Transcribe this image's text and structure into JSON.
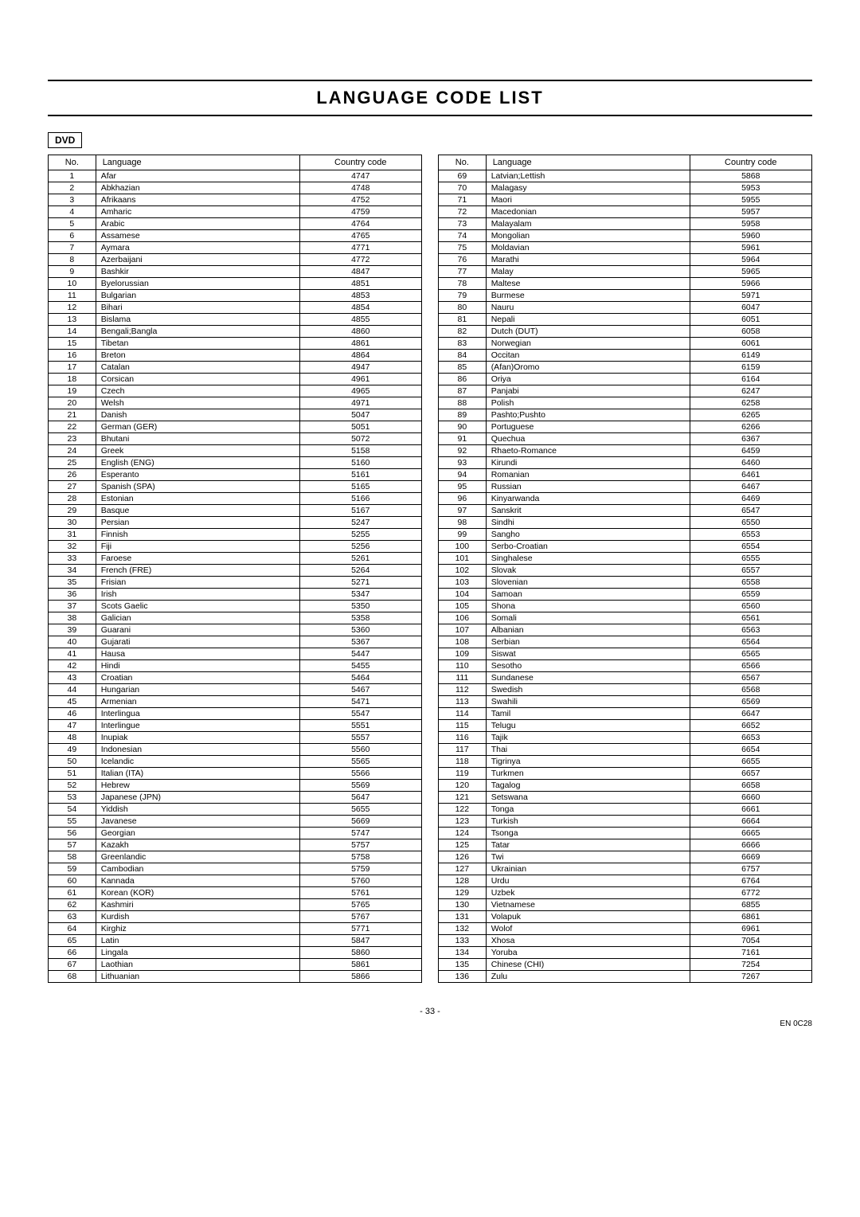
{
  "title": "LANGUAGE CODE LIST",
  "dvd_label": "DVD",
  "footer_page": "- 33 -",
  "footer_code": "EN\n0C28",
  "columns": {
    "no": "No.",
    "language": "Language",
    "country_code": "Country code"
  },
  "left_table": [
    {
      "no": 1,
      "lang": "Afar",
      "code": "4747"
    },
    {
      "no": 2,
      "lang": "Abkhazian",
      "code": "4748"
    },
    {
      "no": 3,
      "lang": "Afrikaans",
      "code": "4752"
    },
    {
      "no": 4,
      "lang": "Amharic",
      "code": "4759"
    },
    {
      "no": 5,
      "lang": "Arabic",
      "code": "4764"
    },
    {
      "no": 6,
      "lang": "Assamese",
      "code": "4765"
    },
    {
      "no": 7,
      "lang": "Aymara",
      "code": "4771"
    },
    {
      "no": 8,
      "lang": "Azerbaijani",
      "code": "4772"
    },
    {
      "no": 9,
      "lang": "Bashkir",
      "code": "4847"
    },
    {
      "no": 10,
      "lang": "Byelorussian",
      "code": "4851"
    },
    {
      "no": 11,
      "lang": "Bulgarian",
      "code": "4853"
    },
    {
      "no": 12,
      "lang": "Bihari",
      "code": "4854"
    },
    {
      "no": 13,
      "lang": "Bislama",
      "code": "4855"
    },
    {
      "no": 14,
      "lang": "Bengali;Bangla",
      "code": "4860"
    },
    {
      "no": 15,
      "lang": "Tibetan",
      "code": "4861"
    },
    {
      "no": 16,
      "lang": "Breton",
      "code": "4864"
    },
    {
      "no": 17,
      "lang": "Catalan",
      "code": "4947"
    },
    {
      "no": 18,
      "lang": "Corsican",
      "code": "4961"
    },
    {
      "no": 19,
      "lang": "Czech",
      "code": "4965"
    },
    {
      "no": 20,
      "lang": "Welsh",
      "code": "4971"
    },
    {
      "no": 21,
      "lang": "Danish",
      "code": "5047"
    },
    {
      "no": 22,
      "lang": "German (GER)",
      "code": "5051"
    },
    {
      "no": 23,
      "lang": "Bhutani",
      "code": "5072"
    },
    {
      "no": 24,
      "lang": "Greek",
      "code": "5158"
    },
    {
      "no": 25,
      "lang": "English (ENG)",
      "code": "5160"
    },
    {
      "no": 26,
      "lang": "Esperanto",
      "code": "5161"
    },
    {
      "no": 27,
      "lang": "Spanish (SPA)",
      "code": "5165"
    },
    {
      "no": 28,
      "lang": "Estonian",
      "code": "5166"
    },
    {
      "no": 29,
      "lang": "Basque",
      "code": "5167"
    },
    {
      "no": 30,
      "lang": "Persian",
      "code": "5247"
    },
    {
      "no": 31,
      "lang": "Finnish",
      "code": "5255"
    },
    {
      "no": 32,
      "lang": "Fiji",
      "code": "5256"
    },
    {
      "no": 33,
      "lang": "Faroese",
      "code": "5261"
    },
    {
      "no": 34,
      "lang": "French (FRE)",
      "code": "5264"
    },
    {
      "no": 35,
      "lang": "Frisian",
      "code": "5271"
    },
    {
      "no": 36,
      "lang": "Irish",
      "code": "5347"
    },
    {
      "no": 37,
      "lang": "Scots Gaelic",
      "code": "5350"
    },
    {
      "no": 38,
      "lang": "Galician",
      "code": "5358"
    },
    {
      "no": 39,
      "lang": "Guarani",
      "code": "5360"
    },
    {
      "no": 40,
      "lang": "Gujarati",
      "code": "5367"
    },
    {
      "no": 41,
      "lang": "Hausa",
      "code": "5447"
    },
    {
      "no": 42,
      "lang": "Hindi",
      "code": "5455"
    },
    {
      "no": 43,
      "lang": "Croatian",
      "code": "5464"
    },
    {
      "no": 44,
      "lang": "Hungarian",
      "code": "5467"
    },
    {
      "no": 45,
      "lang": "Armenian",
      "code": "5471"
    },
    {
      "no": 46,
      "lang": "Interlingua",
      "code": "5547"
    },
    {
      "no": 47,
      "lang": "Interlingue",
      "code": "5551"
    },
    {
      "no": 48,
      "lang": "Inupiak",
      "code": "5557"
    },
    {
      "no": 49,
      "lang": "Indonesian",
      "code": "5560"
    },
    {
      "no": 50,
      "lang": "Icelandic",
      "code": "5565"
    },
    {
      "no": 51,
      "lang": "Italian (ITA)",
      "code": "5566"
    },
    {
      "no": 52,
      "lang": "Hebrew",
      "code": "5569"
    },
    {
      "no": 53,
      "lang": "Japanese (JPN)",
      "code": "5647"
    },
    {
      "no": 54,
      "lang": "Yiddish",
      "code": "5655"
    },
    {
      "no": 55,
      "lang": "Javanese",
      "code": "5669"
    },
    {
      "no": 56,
      "lang": "Georgian",
      "code": "5747"
    },
    {
      "no": 57,
      "lang": "Kazakh",
      "code": "5757"
    },
    {
      "no": 58,
      "lang": "Greenlandic",
      "code": "5758"
    },
    {
      "no": 59,
      "lang": "Cambodian",
      "code": "5759"
    },
    {
      "no": 60,
      "lang": "Kannada",
      "code": "5760"
    },
    {
      "no": 61,
      "lang": "Korean (KOR)",
      "code": "5761"
    },
    {
      "no": 62,
      "lang": "Kashmiri",
      "code": "5765"
    },
    {
      "no": 63,
      "lang": "Kurdish",
      "code": "5767"
    },
    {
      "no": 64,
      "lang": "Kirghiz",
      "code": "5771"
    },
    {
      "no": 65,
      "lang": "Latin",
      "code": "5847"
    },
    {
      "no": 66,
      "lang": "Lingala",
      "code": "5860"
    },
    {
      "no": 67,
      "lang": "Laothian",
      "code": "5861"
    },
    {
      "no": 68,
      "lang": "Lithuanian",
      "code": "5866"
    }
  ],
  "right_table": [
    {
      "no": 69,
      "lang": "Latvian;Lettish",
      "code": "5868"
    },
    {
      "no": 70,
      "lang": "Malagasy",
      "code": "5953"
    },
    {
      "no": 71,
      "lang": "Maori",
      "code": "5955"
    },
    {
      "no": 72,
      "lang": "Macedonian",
      "code": "5957"
    },
    {
      "no": 73,
      "lang": "Malayalam",
      "code": "5958"
    },
    {
      "no": 74,
      "lang": "Mongolian",
      "code": "5960"
    },
    {
      "no": 75,
      "lang": "Moldavian",
      "code": "5961"
    },
    {
      "no": 76,
      "lang": "Marathi",
      "code": "5964"
    },
    {
      "no": 77,
      "lang": "Malay",
      "code": "5965"
    },
    {
      "no": 78,
      "lang": "Maltese",
      "code": "5966"
    },
    {
      "no": 79,
      "lang": "Burmese",
      "code": "5971"
    },
    {
      "no": 80,
      "lang": "Nauru",
      "code": "6047"
    },
    {
      "no": 81,
      "lang": "Nepali",
      "code": "6051"
    },
    {
      "no": 82,
      "lang": "Dutch (DUT)",
      "code": "6058"
    },
    {
      "no": 83,
      "lang": "Norwegian",
      "code": "6061"
    },
    {
      "no": 84,
      "lang": "Occitan",
      "code": "6149"
    },
    {
      "no": 85,
      "lang": "(Afan)Oromo",
      "code": "6159"
    },
    {
      "no": 86,
      "lang": "Oriya",
      "code": "6164"
    },
    {
      "no": 87,
      "lang": "Panjabi",
      "code": "6247"
    },
    {
      "no": 88,
      "lang": "Polish",
      "code": "6258"
    },
    {
      "no": 89,
      "lang": "Pashto;Pushto",
      "code": "6265"
    },
    {
      "no": 90,
      "lang": "Portuguese",
      "code": "6266"
    },
    {
      "no": 91,
      "lang": "Quechua",
      "code": "6367"
    },
    {
      "no": 92,
      "lang": "Rhaeto-Romance",
      "code": "6459"
    },
    {
      "no": 93,
      "lang": "Kirundi",
      "code": "6460"
    },
    {
      "no": 94,
      "lang": "Romanian",
      "code": "6461"
    },
    {
      "no": 95,
      "lang": "Russian",
      "code": "6467"
    },
    {
      "no": 96,
      "lang": "Kinyarwanda",
      "code": "6469"
    },
    {
      "no": 97,
      "lang": "Sanskrit",
      "code": "6547"
    },
    {
      "no": 98,
      "lang": "Sindhi",
      "code": "6550"
    },
    {
      "no": 99,
      "lang": "Sangho",
      "code": "6553"
    },
    {
      "no": 100,
      "lang": "Serbo-Croatian",
      "code": "6554"
    },
    {
      "no": 101,
      "lang": "Singhalese",
      "code": "6555"
    },
    {
      "no": 102,
      "lang": "Slovak",
      "code": "6557"
    },
    {
      "no": 103,
      "lang": "Slovenian",
      "code": "6558"
    },
    {
      "no": 104,
      "lang": "Samoan",
      "code": "6559"
    },
    {
      "no": 105,
      "lang": "Shona",
      "code": "6560"
    },
    {
      "no": 106,
      "lang": "Somali",
      "code": "6561"
    },
    {
      "no": 107,
      "lang": "Albanian",
      "code": "6563"
    },
    {
      "no": 108,
      "lang": "Serbian",
      "code": "6564"
    },
    {
      "no": 109,
      "lang": "Siswat",
      "code": "6565"
    },
    {
      "no": 110,
      "lang": "Sesotho",
      "code": "6566"
    },
    {
      "no": 111,
      "lang": "Sundanese",
      "code": "6567"
    },
    {
      "no": 112,
      "lang": "Swedish",
      "code": "6568"
    },
    {
      "no": 113,
      "lang": "Swahili",
      "code": "6569"
    },
    {
      "no": 114,
      "lang": "Tamil",
      "code": "6647"
    },
    {
      "no": 115,
      "lang": "Telugu",
      "code": "6652"
    },
    {
      "no": 116,
      "lang": "Tajik",
      "code": "6653"
    },
    {
      "no": 117,
      "lang": "Thai",
      "code": "6654"
    },
    {
      "no": 118,
      "lang": "Tigrinya",
      "code": "6655"
    },
    {
      "no": 119,
      "lang": "Turkmen",
      "code": "6657"
    },
    {
      "no": 120,
      "lang": "Tagalog",
      "code": "6658"
    },
    {
      "no": 121,
      "lang": "Setswana",
      "code": "6660"
    },
    {
      "no": 122,
      "lang": "Tonga",
      "code": "6661"
    },
    {
      "no": 123,
      "lang": "Turkish",
      "code": "6664"
    },
    {
      "no": 124,
      "lang": "Tsonga",
      "code": "6665"
    },
    {
      "no": 125,
      "lang": "Tatar",
      "code": "6666"
    },
    {
      "no": 126,
      "lang": "Twi",
      "code": "6669"
    },
    {
      "no": 127,
      "lang": "Ukrainian",
      "code": "6757"
    },
    {
      "no": 128,
      "lang": "Urdu",
      "code": "6764"
    },
    {
      "no": 129,
      "lang": "Uzbek",
      "code": "6772"
    },
    {
      "no": 130,
      "lang": "Vietnamese",
      "code": "6855"
    },
    {
      "no": 131,
      "lang": "Volapuk",
      "code": "6861"
    },
    {
      "no": 132,
      "lang": "Wolof",
      "code": "6961"
    },
    {
      "no": 133,
      "lang": "Xhosa",
      "code": "7054"
    },
    {
      "no": 134,
      "lang": "Yoruba",
      "code": "7161"
    },
    {
      "no": 135,
      "lang": "Chinese (CHI)",
      "code": "7254"
    },
    {
      "no": 136,
      "lang": "Zulu",
      "code": "7267"
    }
  ]
}
